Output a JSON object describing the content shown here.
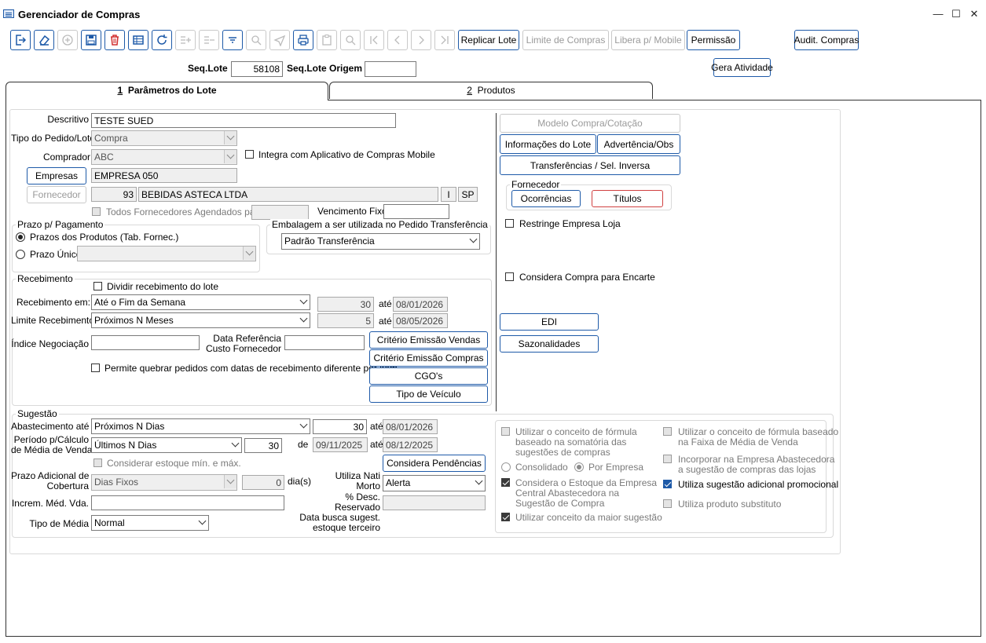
{
  "window": {
    "title": "Gerenciador de Compras",
    "minimize": "—",
    "maximize": "☐",
    "close": "✕"
  },
  "toolbar": {
    "buttons": {
      "replicar_lote": "Replicar Lote",
      "limite_compras": "Limite de Compras",
      "libera_mobile": "Libera p/ Mobile",
      "permissao": "Permissão",
      "audit_compras": "Audit. Compras",
      "gera_atividade": "Gera Atividade"
    }
  },
  "header": {
    "seq_lote_label": "Seq.Lote",
    "seq_lote_value": "58108",
    "seq_lote_origem_label": "Seq.Lote Origem",
    "seq_lote_origem_value": ""
  },
  "tabs": [
    {
      "num": "1",
      "label": "Parâmetros do Lote"
    },
    {
      "num": "2",
      "label": "Produtos"
    }
  ],
  "lote": {
    "descritivo_label": "Descritivo",
    "descritivo_value": "TESTE SUED",
    "tipo_pedido_label": "Tipo do Pedido/Lote",
    "tipo_pedido_value": "Compra",
    "comprador_label": "Comprador",
    "comprador_value": "ABC",
    "integra_mobile_label": "Integra com Aplicativo de Compras Mobile",
    "empresas_button": "Empresas",
    "empresa_value": "EMPRESA 050",
    "fornecedor_button": "Fornecedor",
    "fornecedor_code": "93",
    "fornecedor_name": "BEBIDAS ASTECA LTDA",
    "fornecedor_i": "I",
    "fornecedor_uf": "SP",
    "todos_fornec_label": "Todos Fornecedores Agendados para",
    "vencimento_label": "Vencimento Fixo"
  },
  "prazo": {
    "title": "Prazo p/ Pagamento",
    "opt1": "Prazos dos Produtos (Tab. Fornec.)",
    "opt2": "Prazo Único"
  },
  "embalagem": {
    "title": "Embalagem a ser utilizada no Pedido Transferência",
    "value": "Padrão Transferência"
  },
  "recebimento": {
    "title": "Recebimento",
    "dividir_label": "Dividir recebimento do lote",
    "receb_em_label": "Recebimento em:",
    "receb_em_value": "Até o Fim da Semana",
    "receb_em_num": "30",
    "receb_em_ate": "até",
    "receb_em_date": "08/01/2026",
    "limite_label": "Limite Recebimento:",
    "limite_value": "Próximos N Meses",
    "limite_num": "5",
    "limite_ate": "até",
    "limite_date": "08/05/2026",
    "indice_label": "Índice Negociação",
    "data_ref_label1": "Data Referência",
    "data_ref_label2": "Custo Fornecedor",
    "permite_label": "Permite quebrar pedidos com datas de recebimento diferente por item",
    "criterio_vendas": "Critério Emissão Vendas",
    "criterio_compras": "Critério Emissão Compras",
    "cgos": "CGO's",
    "tipo_veiculo": "Tipo de Veículo"
  },
  "right_panel": {
    "modelo_compra": "Modelo Compra/Cotação",
    "informacoes_lote": "Informações do Lote",
    "advertencia": "Advertência/Obs",
    "transferencias": "Transferências / Sel. Inversa",
    "fornecedor_group": "Fornecedor",
    "ocorrencias": "Ocorrências",
    "titulos": "Títulos",
    "restringe_label": "Restringe Empresa Loja",
    "considera_encarte_label": "Considera Compra para Encarte",
    "edi": "EDI",
    "sazonalidades": "Sazonalidades"
  },
  "sugestao": {
    "title": "Sugestão",
    "abastecimento_label": "Abastecimento até",
    "abastecimento_value": "Próximos N Dias",
    "abastecimento_num": "30",
    "abastecimento_ate": "até",
    "abastecimento_date": "08/01/2026",
    "periodo_label1": "Período p/Cálculo",
    "periodo_label2": "de Média de Venda",
    "periodo_value": "Últimos N Dias",
    "periodo_num": "30",
    "periodo_de": "de",
    "periodo_from": "09/11/2025",
    "periodo_ate": "até",
    "periodo_to": "08/12/2025",
    "considerar_estoque_label": "Considerar estoque mín. e máx.",
    "considera_pendencias": "Considera Pendências",
    "prazo_adic_label1": "Prazo Adicional de",
    "prazo_adic_label2": "Cobertura",
    "prazo_adic_value": "Dias Fixos",
    "prazo_adic_num": "0",
    "dias_label": "dia(s)",
    "utiliza_nati_label1": "Utiliza Nati",
    "utiliza_nati_label2": "Morto",
    "utiliza_nati_value": "Alerta",
    "increm_label": "Increm. Méd. Vda.",
    "desc_reservado_label1": "% Desc.",
    "desc_reservado_label2": "Reservado",
    "tipo_media_label": "Tipo de Média",
    "tipo_media_value": "Normal",
    "data_busca_label1": "Data busca sugest.",
    "data_busca_label2": "estoque terceiro"
  },
  "formula": {
    "conceito_formula_1": "Utilizar o conceito de fórmula",
    "conceito_formula_2": "baseado na somatória das",
    "conceito_formula_3": "sugestões de compras",
    "consolidado": "Consolidado",
    "por_empresa": "Por Empresa",
    "considera_estoque_1": "Considera o Estoque da Empresa",
    "considera_estoque_2": "Central Abastecedora na",
    "considera_estoque_3": "Sugestão de Compra",
    "maior_sugestao": "Utilizar conceito da maior sugestão",
    "faixa_1": "Utilizar o conceito de fórmula baseado",
    "faixa_2": "na Faixa de Média de Venda",
    "incorporar_1": "Incorporar na Empresa Abastecedora",
    "incorporar_2": "a sugestão de compras das lojas",
    "sugestao_promocional": "Utiliza sugestão adicional promocional",
    "produto_substituto": "Utiliza produto substituto"
  }
}
